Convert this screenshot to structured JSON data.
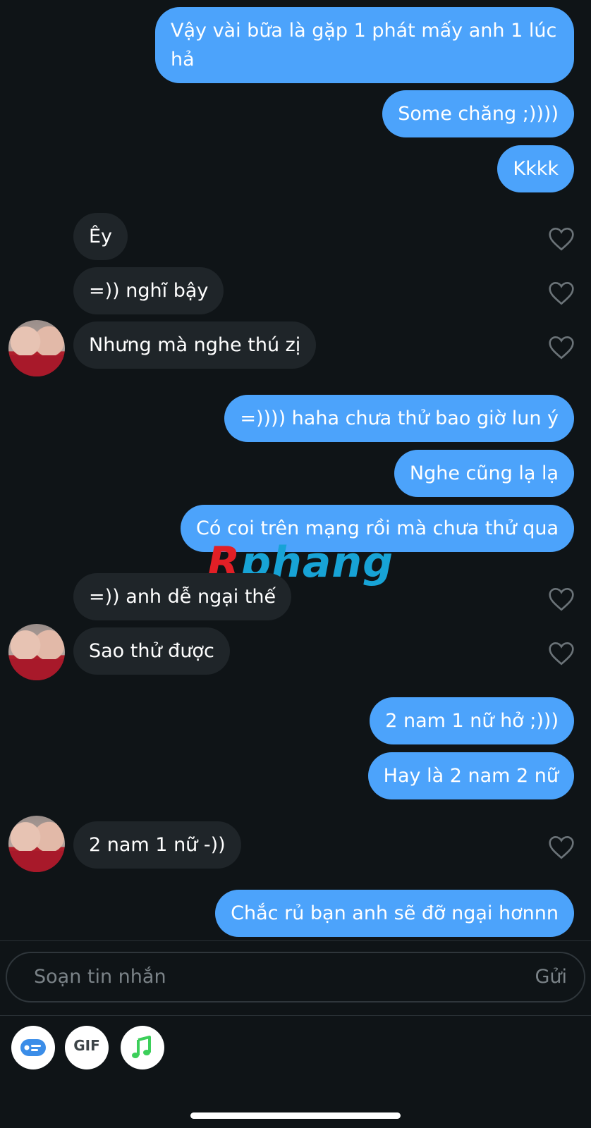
{
  "messages": [
    {
      "dir": "out",
      "text": "Vậy vài bữa là gặp 1 phát mấy anh 1 lúc hả"
    },
    {
      "dir": "out",
      "text": "Some chăng ;))))"
    },
    {
      "dir": "out",
      "text": "Kkkk"
    },
    {
      "dir": "in",
      "text": "Êy"
    },
    {
      "dir": "in",
      "text": "=)) nghĩ bậy"
    },
    {
      "dir": "in",
      "text": "Nhưng mà nghe thú zị"
    },
    {
      "dir": "out",
      "text": "=)))) haha chưa thử bao giờ lun ý"
    },
    {
      "dir": "out",
      "text": "Nghe cũng lạ lạ"
    },
    {
      "dir": "out",
      "text": "Có coi trên mạng rồi mà chưa thử qua"
    },
    {
      "dir": "in",
      "text": "=)) anh dễ ngại thế"
    },
    {
      "dir": "in",
      "text": "Sao thử được"
    },
    {
      "dir": "out",
      "text": "2 nam 1 nữ hở ;)))"
    },
    {
      "dir": "out",
      "text": "Hay là 2 nam 2 nữ"
    },
    {
      "dir": "in",
      "text": "2 nam 1 nữ -))"
    },
    {
      "dir": "out",
      "text": "Chắc rủ bạn anh sẽ đỡ ngại hơnnn"
    }
  ],
  "watermark": {
    "first": "R",
    "rest": "phang"
  },
  "composer": {
    "placeholder": "Soạn tin nhắn",
    "send_label": "Gửi"
  },
  "toolbar": {
    "gif_label": "GIF",
    "icons": [
      "contact-card-icon",
      "gif-icon",
      "music-note-icon"
    ]
  },
  "colors": {
    "background": "#0f1417",
    "outgoing_bubble": "#4ca3fb",
    "incoming_bubble": "#1f2529",
    "placeholder_text": "#7b8388",
    "music_icon": "#3ccf5a",
    "card_icon": "#3b8de8"
  }
}
